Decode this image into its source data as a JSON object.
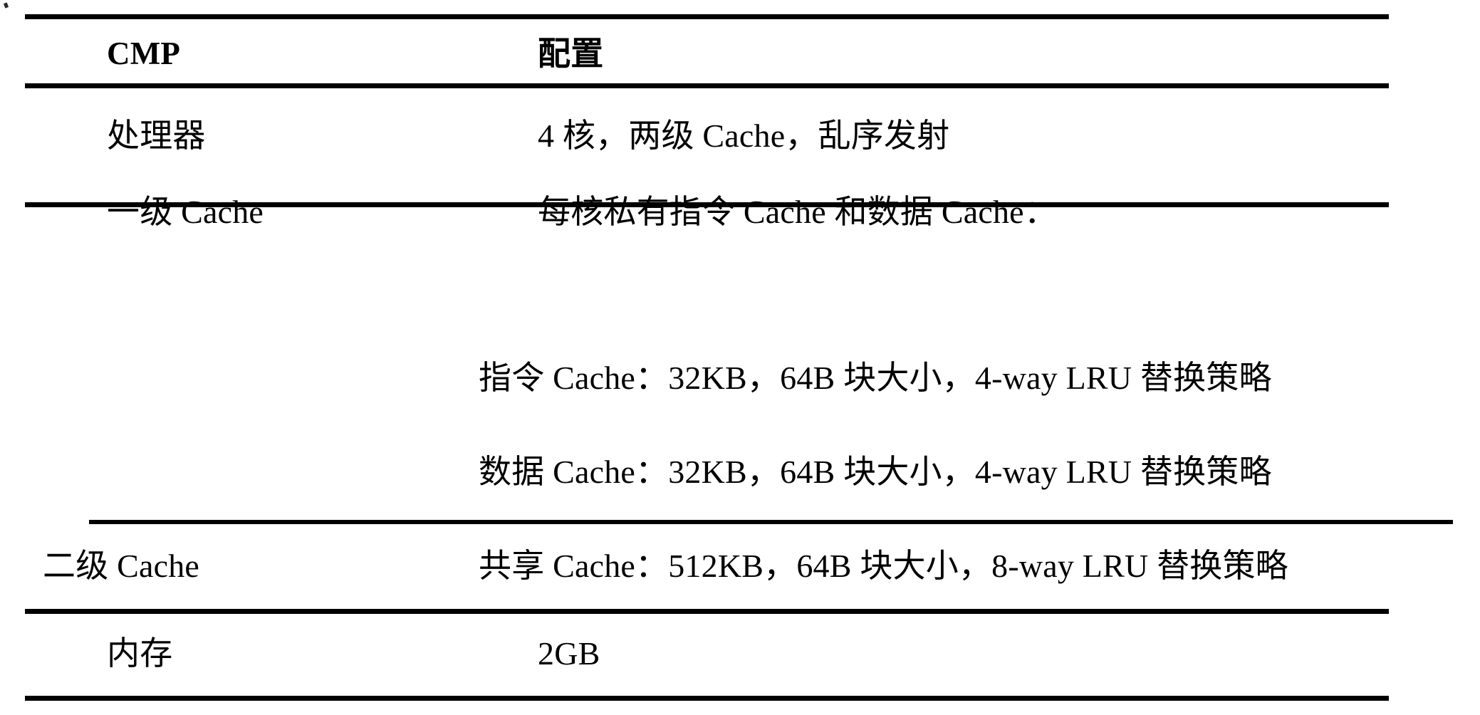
{
  "document": {
    "type": "table",
    "title": "CMP 配置",
    "background_color": "#ffffff",
    "text_color": "#000000",
    "rule_color": "#000000"
  },
  "table": {
    "columns": [
      {
        "key": "name",
        "header": "CMP"
      },
      {
        "key": "config",
        "header": "配置"
      }
    ],
    "rows": [
      {
        "name": "处理器",
        "lines": [
          "4 核，两级 Cache，乱序发射"
        ]
      },
      {
        "name": "一级 Cache",
        "lines": [
          "每核私有指令 Cache 和数据 Cache：",
          "指令 Cache：32KB，64B 块大小，4-way LRU 替换策略",
          "数据 Cache：32KB，64B 块大小，4-way LRU 替换策略"
        ]
      },
      {
        "name": "二级 Cache",
        "lines": [
          "共享 Cache：512KB，64B 块大小，8-way LRU 替换策略"
        ]
      },
      {
        "name": "内存",
        "lines": [
          "2GB"
        ]
      }
    ]
  },
  "chart_data": {
    "type": "table",
    "title": "CMP 配置",
    "columns": [
      "CMP",
      "配置"
    ],
    "rows": [
      [
        "处理器",
        "4 核，两级 Cache，乱序发射"
      ],
      [
        "一级 Cache",
        "每核私有指令 Cache 和数据 Cache："
      ],
      [
        "",
        "指令 Cache：32KB，64B 块大小，4-way LRU 替换策略"
      ],
      [
        "",
        "数据 Cache：32KB，64B 块大小，4-way LRU 替换策略"
      ],
      [
        "二级 Cache",
        "共享 Cache：512KB，64B 块大小，8-way LRU 替换策略"
      ],
      [
        "内存",
        "2GB"
      ]
    ]
  }
}
